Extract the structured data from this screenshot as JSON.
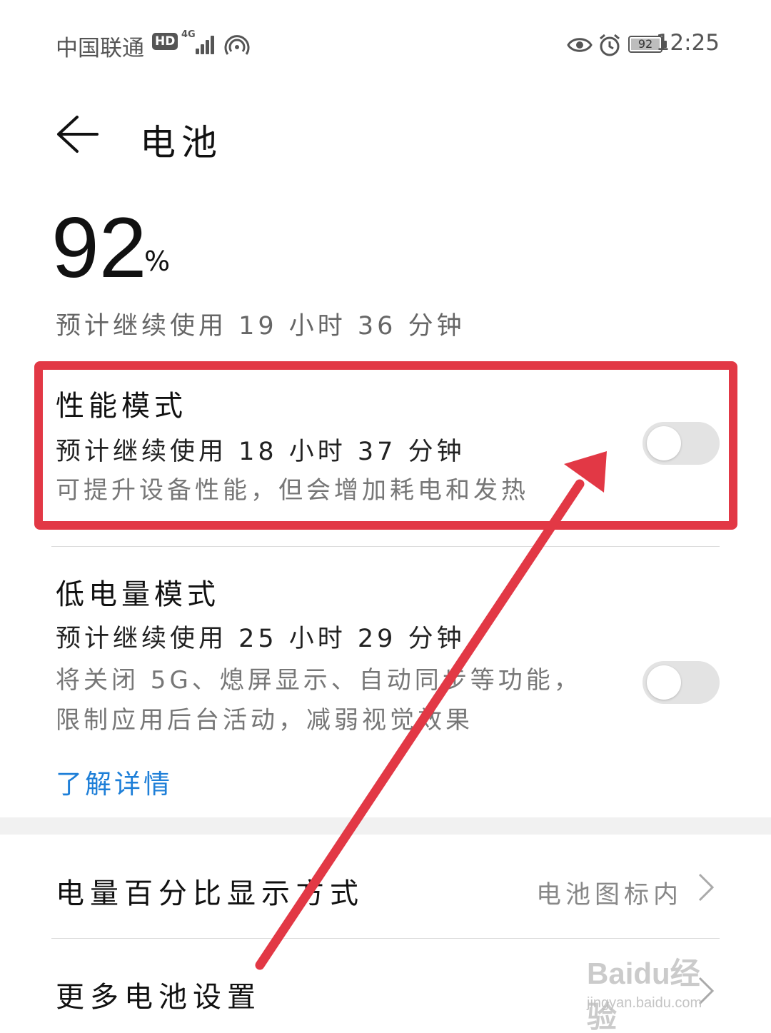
{
  "status_bar": {
    "carrier": "中国联通",
    "hd_badge": "HD",
    "network_type": "4G",
    "battery_level": "92",
    "time": "12:25",
    "icons": [
      "signal-icon",
      "hotspot-icon",
      "eye-icon",
      "alarm-icon",
      "battery-icon"
    ]
  },
  "header": {
    "title": "电池",
    "back_icon": "back-arrow-icon"
  },
  "battery": {
    "percent": "92",
    "percent_sign": "%",
    "remaining": "预计继续使用 19 小时 36 分钟"
  },
  "performance_mode": {
    "title": "性能模式",
    "remaining": "预计继续使用 18 小时 37 分钟",
    "description": "可提升设备性能，但会增加耗电和发热",
    "enabled": false
  },
  "low_power_mode": {
    "title": "低电量模式",
    "remaining": "预计继续使用 25 小时 29 分钟",
    "description_line1": "将关闭 5G、熄屏显示、自动同步等功能，",
    "description_line2": "限制应用后台活动，减弱视觉效果",
    "learn_more": "了解详情",
    "enabled": false
  },
  "settings_rows": [
    {
      "label": "电量百分比显示方式",
      "value": "电池图标内"
    },
    {
      "label": "更多电池设置",
      "value": ""
    }
  ],
  "annotation": {
    "highlight_color": "#e23845"
  },
  "watermark": {
    "logo": "Baidu经验",
    "url": "jingyan.baidu.com"
  },
  "colors": {
    "link": "#1e7fd8",
    "toggle_off": "#e3e3e3",
    "annotation_red": "#e23845"
  }
}
